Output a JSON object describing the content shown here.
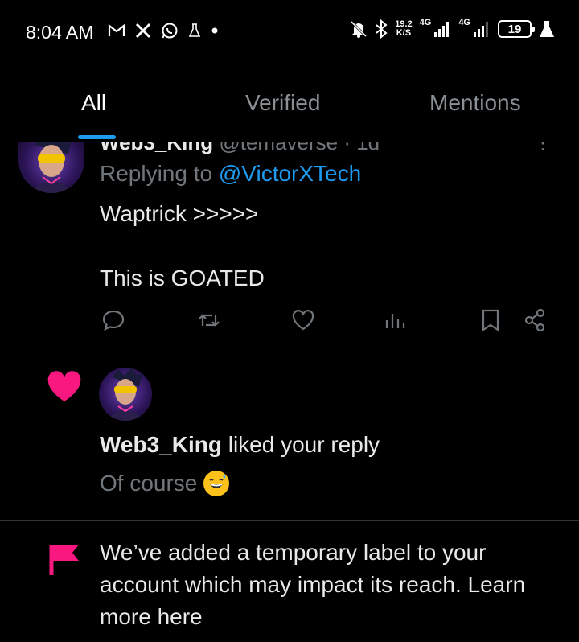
{
  "status_bar": {
    "time": "8:04 AM",
    "left_icons": [
      "gmail-icon",
      "x-icon",
      "whatsapp-icon",
      "flask-icon",
      "dot-icon"
    ],
    "net_speed_value": "19.2",
    "net_speed_unit": "K/S",
    "signal1_label": "4G",
    "signal2_label": "4G",
    "battery": "19"
  },
  "tabs": [
    {
      "label": "All",
      "active": true
    },
    {
      "label": "Verified",
      "active": false
    },
    {
      "label": "Mentions",
      "active": false
    }
  ],
  "reply_tweet": {
    "author": "Web3_King",
    "handle": "@temaverse · 1d",
    "replying_prefix": "Replying to ",
    "replying_mention": "@VictorXTech",
    "body_line1": "Waptrick >>>>>",
    "body_line2": "This is GOATED"
  },
  "like_notification": {
    "user": "Web3_King",
    "action_text": " liked your reply",
    "quote": "Of course"
  },
  "flag_notification": {
    "text": "We’ve added a temporary label to your account which may impact its reach.",
    "link": "Learn more here"
  },
  "colors": {
    "background": "#000000",
    "accent": "#1d9bf0",
    "heart": "#f91880",
    "muted": "#71767b"
  }
}
